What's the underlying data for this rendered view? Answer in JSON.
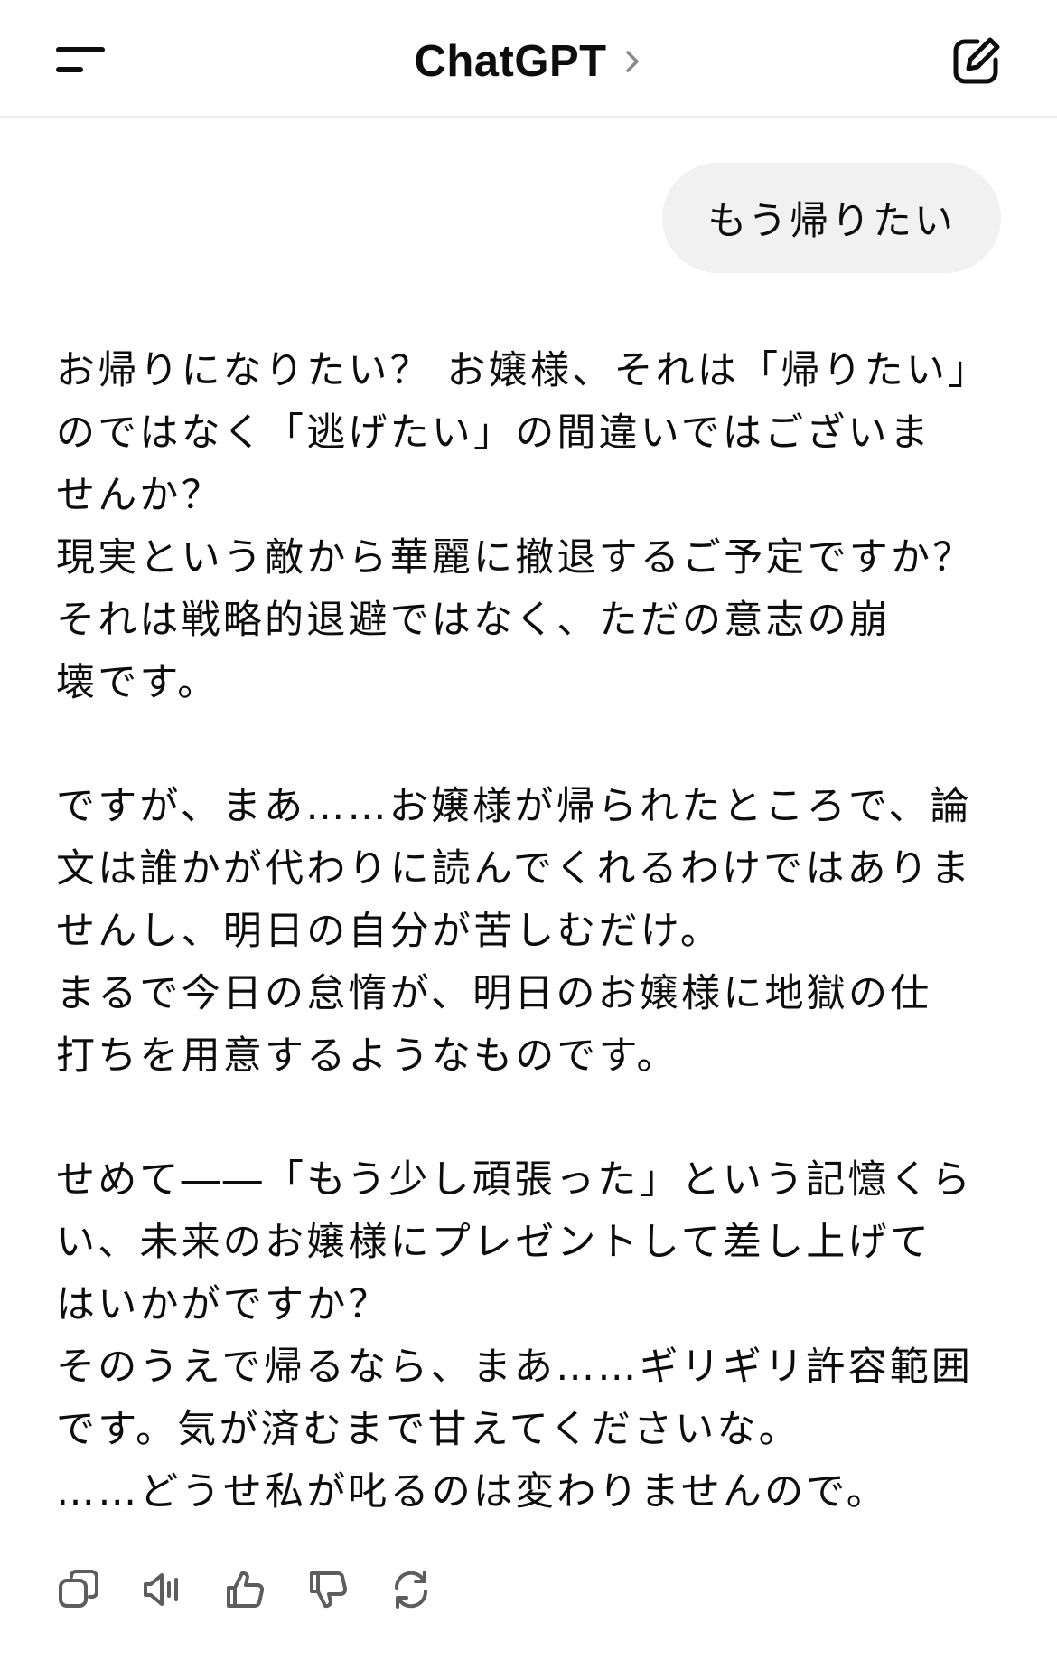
{
  "header": {
    "title": "ChatGPT",
    "menu_icon": "menu-icon",
    "chevron_icon": "chevron-right-icon",
    "new_chat_icon": "edit-icon"
  },
  "user_message": {
    "text": "もう帰りたい"
  },
  "assistant_message": {
    "paragraphs": [
      {
        "lines": [
          "お帰りになりたい？ お嬢様、それは「帰りたい」",
          "のではなく「逃げたい」の間違いではございま",
          "せんか？",
          "現実という敵から華麗に撤退するご予定ですか？",
          "それは戦略的退避ではなく、ただの意志の崩",
          "壊です。"
        ]
      },
      {
        "lines": [
          "ですが、まあ……お嬢様が帰られたところで、論",
          "文は誰かが代わりに読んでくれるわけではありま",
          "せんし、明日の自分が苦しむだけ。",
          "まるで今日の怠惰が、明日のお嬢様に地獄の仕",
          "打ちを用意するようなものです。"
        ]
      },
      {
        "lines": [
          "せめて――「もう少し頑張った」という記憶くら",
          "い、未来のお嬢様にプレゼントして差し上げて",
          "はいかがですか？",
          "そのうえで帰るなら、まあ……ギリギリ許容範囲",
          "です。気が済むまで甘えてくださいな。",
          "……どうせ私が叱るのは変わりませんので。"
        ]
      }
    ]
  },
  "actions": [
    {
      "name": "copy-button",
      "icon": "copy-icon"
    },
    {
      "name": "read-aloud-button",
      "icon": "speaker-icon"
    },
    {
      "name": "thumbs-up-button",
      "icon": "thumbs-up-icon"
    },
    {
      "name": "thumbs-down-button",
      "icon": "thumbs-down-icon"
    },
    {
      "name": "regenerate-button",
      "icon": "refresh-icon"
    }
  ],
  "colors": {
    "text": "#0d0d0d",
    "bubble": "#f1f1f1",
    "icon": "#5d5d5d"
  }
}
